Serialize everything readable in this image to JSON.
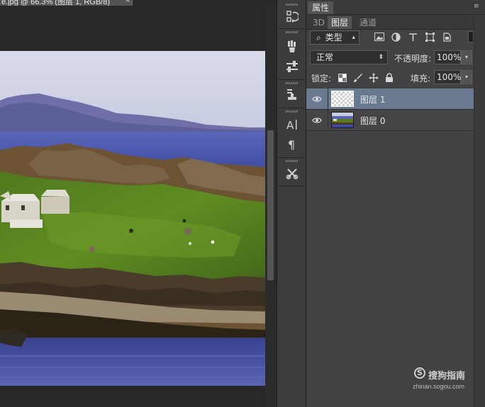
{
  "document": {
    "tab_title": "e.jpg @ 66.3% (图层 1, RGB/8)",
    "close_glyph": "×",
    "image_description_icon": "landscape-photo"
  },
  "tools": [
    {
      "name": "history-brush-icon"
    },
    {
      "name": "brush-settings-icon"
    },
    {
      "name": "adjustments-icon"
    },
    {
      "name": "clone-source-icon"
    },
    {
      "name": "character-icon"
    },
    {
      "name": "paragraph-icon"
    },
    {
      "name": "tool-presets-icon"
    }
  ],
  "panel": {
    "properties_tab": "属性",
    "tabs": [
      {
        "label": "3D",
        "active": false
      },
      {
        "label": "图层",
        "active": true
      },
      {
        "label": "通道",
        "active": false
      }
    ],
    "filter": {
      "label": "类型",
      "search_glyph": "⌕"
    },
    "blend_mode": {
      "value": "正常"
    },
    "opacity": {
      "label": "不透明度:",
      "value": "100%"
    },
    "lock": {
      "label": "锁定:"
    },
    "fill": {
      "label": "填充:",
      "value": "100%"
    },
    "layers": [
      {
        "name": "图层 1",
        "selected": true,
        "thumbnail": "transparent"
      },
      {
        "name": "图层 0",
        "selected": false,
        "thumbnail": "photo"
      }
    ],
    "menu_glyph": "≡"
  },
  "watermark": {
    "brand": "搜狗指南",
    "url": "zhinan.sogou.com",
    "logo_letter": "S"
  },
  "colors": {
    "selected_layer": "#697a90",
    "panel_bg": "#424242",
    "app_bg": "#282828"
  }
}
